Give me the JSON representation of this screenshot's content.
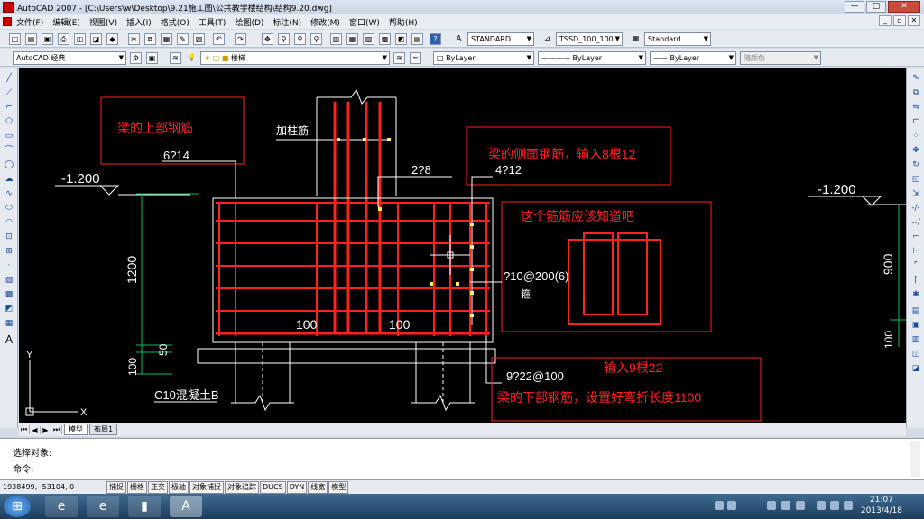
{
  "window": {
    "title": "AutoCAD 2007 - [C:\\Users\\w\\Desktop\\9.21施工图\\公共教学楼结构\\结构9.20.dwg]"
  },
  "menu": [
    "文件(F)",
    "编辑(E)",
    "视图(V)",
    "插入(I)",
    "格式(O)",
    "工具(T)",
    "绘图(D)",
    "标注(N)",
    "修改(M)",
    "窗口(W)",
    "帮助(H)"
  ],
  "toolbar": {
    "text_style": "STANDARD",
    "dim_style": "TSSD_100_100",
    "table_style": "Standard",
    "workspace": "AutoCAD 经典",
    "layer": "楼梯",
    "color": "ByLayer",
    "linetype": "ByLayer",
    "lineweight": "ByLayer",
    "plotstyle": "随颜色"
  },
  "drawing": {
    "note_top_bar": "梁的上部钢筋",
    "top_bar_spec": "6?14",
    "column_bar": "加柱筋",
    "elev_left": "-1.200",
    "stirrup_small": "2?8",
    "side_note": "梁的侧面钢筋，输入8根12",
    "side_spec": "4?12",
    "stirrup_note": "这个箍筋应该知道吧",
    "elev_right": "-1.200",
    "height_left": "1200",
    "height_right": "900",
    "stirrup_spec": "?10@200(6)",
    "stirrup_label": "箍",
    "dim_100a": "100",
    "dim_100b": "100",
    "dim_50": "50",
    "dim_100c": "100",
    "dim_100d": "100",
    "bottom_spec": "9?22@100",
    "bottom_note1": "输入9根22",
    "bottom_note2": "梁的下部钢筋，设置好弯折长度1100",
    "concrete": "C10混凝土B",
    "ucs_y": "Y",
    "ucs_x": "X"
  },
  "tabs": {
    "model": "模型",
    "layout1": "布局1"
  },
  "command": {
    "line1": "选择对象:",
    "line2": "命令:"
  },
  "status": {
    "coords": "1938499, -53104, 0",
    "buttons": [
      "捕捉",
      "栅格",
      "正交",
      "极轴",
      "对象捕捉",
      "对象追踪",
      "DUCS",
      "DYN",
      "线宽",
      "模型"
    ]
  },
  "clock": {
    "time": "21:07",
    "date": "2013/4/18"
  },
  "colors": {
    "canvas": "#000000",
    "rebar": "#ff2020",
    "dims": "#00c060",
    "text": "#ffffff",
    "note": "#ff2020",
    "accent": "#1a4a9a"
  }
}
